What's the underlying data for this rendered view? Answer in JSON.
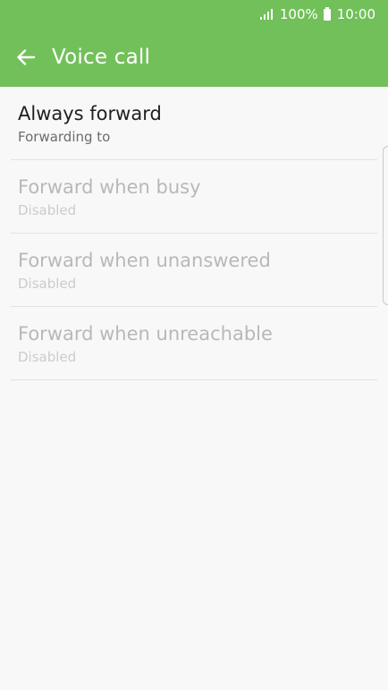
{
  "status_bar": {
    "battery": "100%",
    "time": "10:00"
  },
  "header": {
    "title": "Voice call",
    "back_icon": "arrow-left-icon",
    "color": "#72c05a"
  },
  "items": [
    {
      "title": "Always forward",
      "subtitle": "Forwarding to",
      "enabled": true
    },
    {
      "title": "Forward when busy",
      "subtitle": "Disabled",
      "enabled": false
    },
    {
      "title": "Forward when unanswered",
      "subtitle": "Disabled",
      "enabled": false
    },
    {
      "title": "Forward when unreachable",
      "subtitle": "Disabled",
      "enabled": false
    }
  ]
}
